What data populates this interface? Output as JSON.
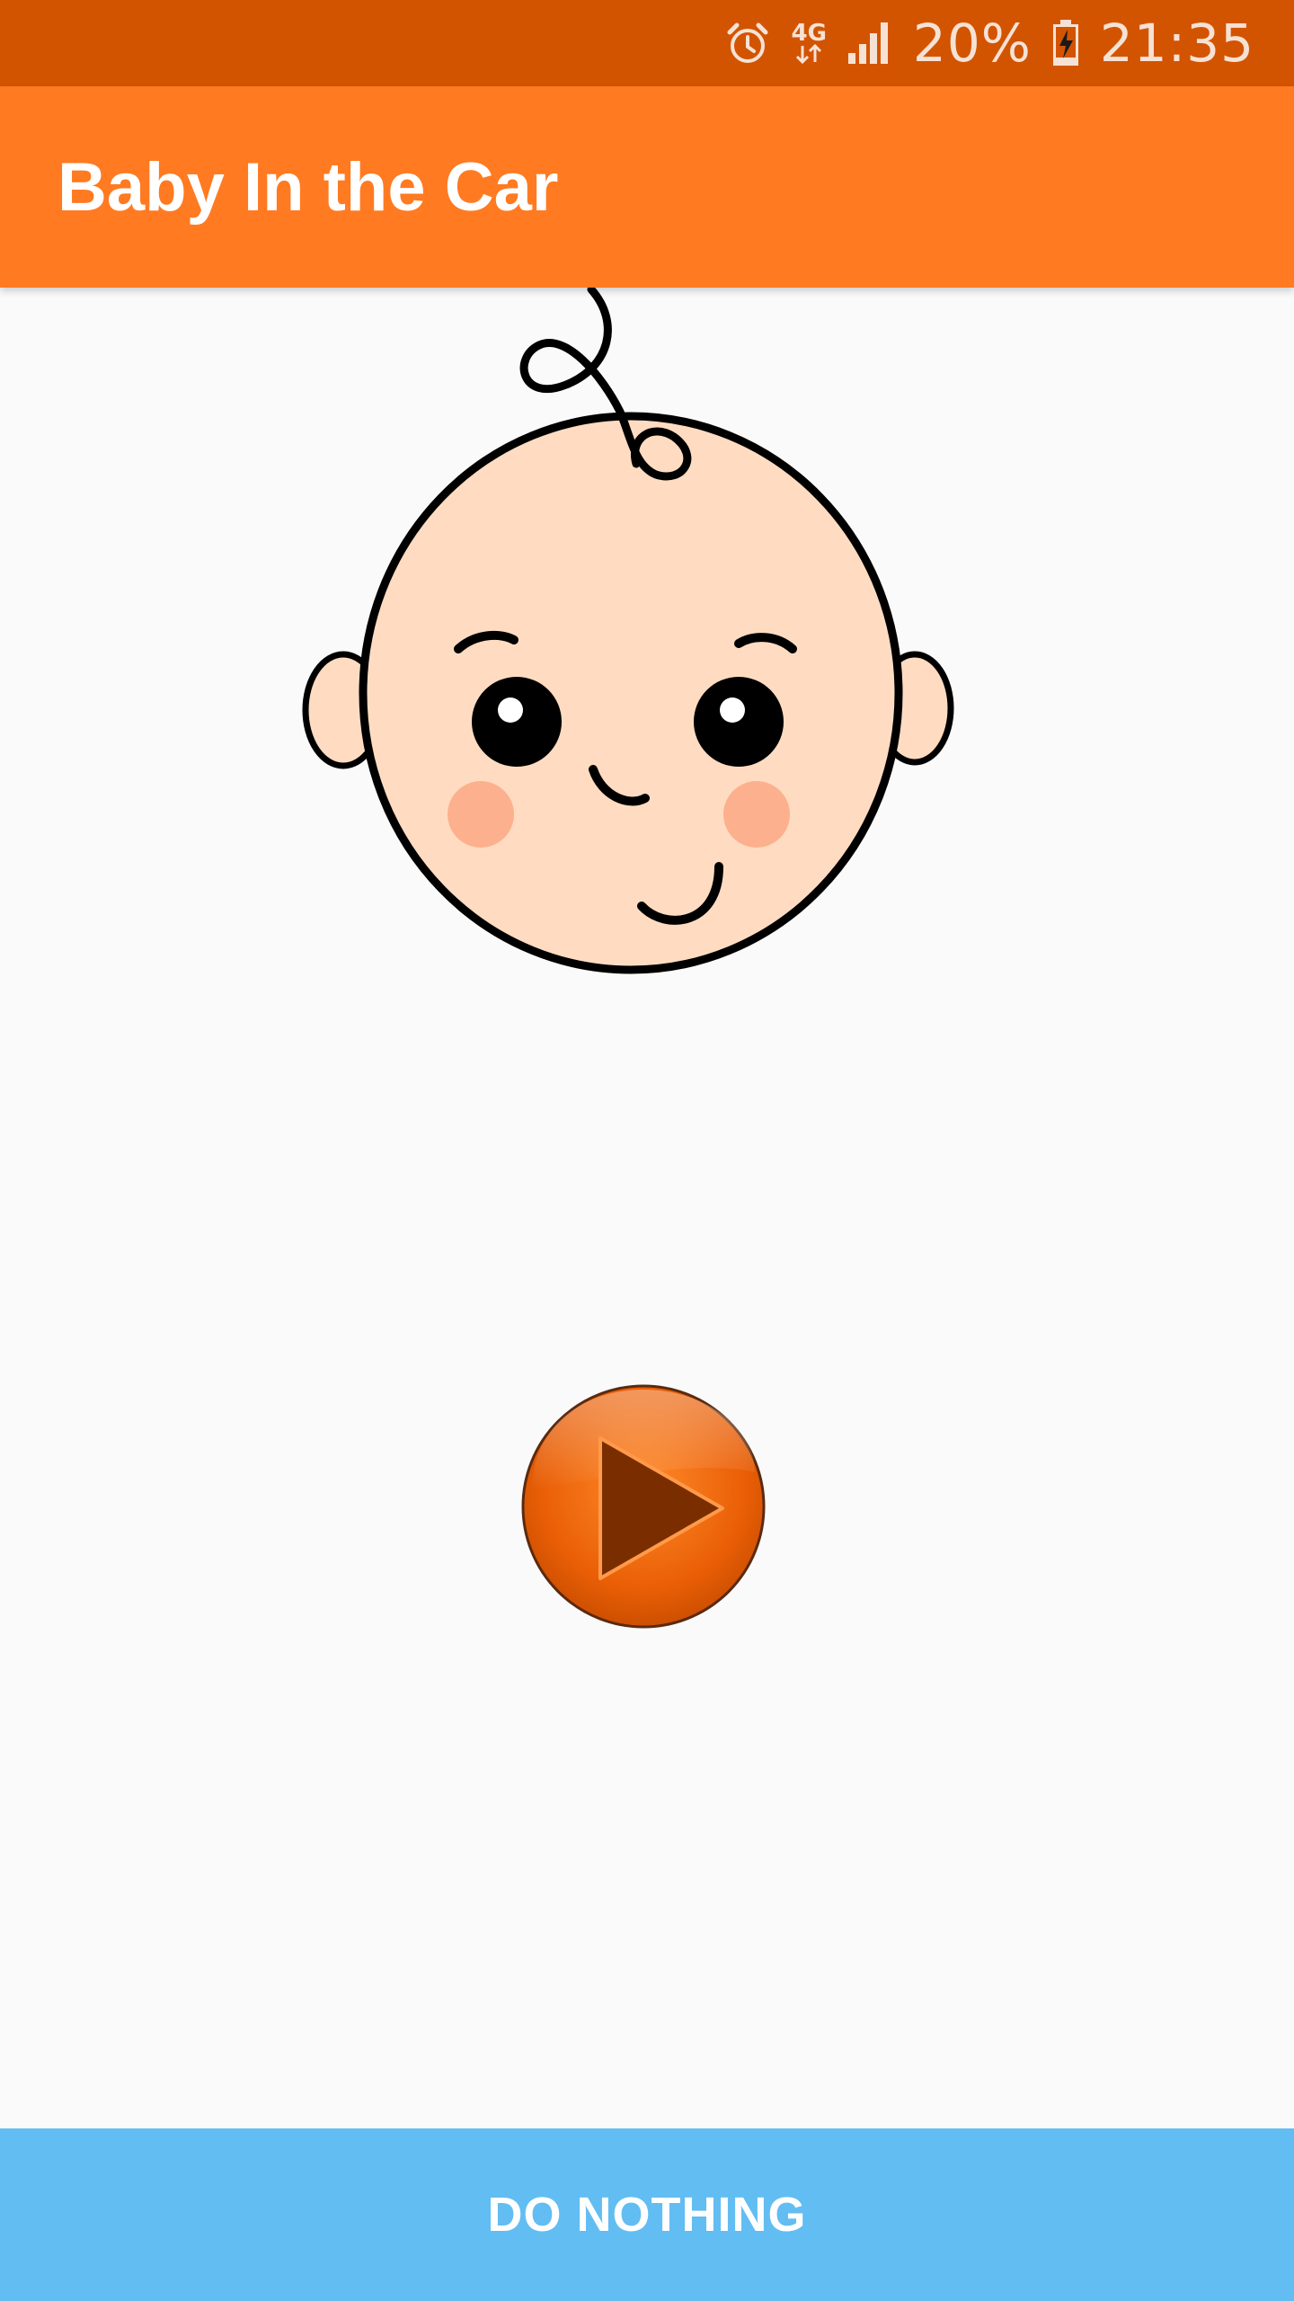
{
  "status_bar": {
    "icons": [
      "alarm-icon",
      "network-4g-icon",
      "signal-icon",
      "battery-charging-icon"
    ],
    "network_label": "4G",
    "battery_percent": "20%",
    "time": "21:35"
  },
  "app_bar": {
    "title": "Baby In the Car"
  },
  "illustration": {
    "icon": "baby-face-icon"
  },
  "play": {
    "icon": "play-icon"
  },
  "bottom_action": {
    "label": "DO NOTHING"
  },
  "colors": {
    "status_bar": "#d35400",
    "app_bar": "#ff7a21",
    "background": "#fafafa",
    "bottom_action": "#62bdf2",
    "play_button": "#f26a0a",
    "baby_skin": "#ffdcc1"
  }
}
